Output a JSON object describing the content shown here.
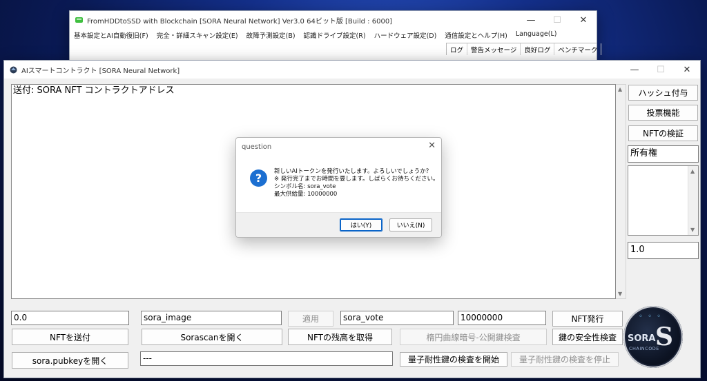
{
  "back_window": {
    "title": "FromHDDtoSSD with Blockchain [SORA Neural Network] Ver3.0 64ビット版 [Build : 6000]",
    "menu": [
      "基本設定とAI自動復旧(F)",
      "完全・詳細スキャン設定(E)",
      "故障予測設定(B)",
      "認識ドライブ設定(R)",
      "ハードウェア設定(D)",
      "通信設定とヘルプ(H)",
      "Language(L)"
    ],
    "tabs": [
      "ログ",
      "警告メッセージ",
      "良好ログ",
      "ベンチマーク"
    ]
  },
  "main_window": {
    "title": "AIスマートコントラクト [SORA Neural Network]",
    "text_area": "送付: SORA NFT コントラクトアドレス",
    "right_panel": {
      "hash_button": "ハッシュ付与",
      "vote_button": "投票機能",
      "nft_verify_button": "NFTの検証",
      "ownership_field": "所有権",
      "version_field": "1.0"
    },
    "row1": {
      "amount_field": "0.0",
      "image_field": "sora_image",
      "apply_button": "適用",
      "symbol_field": "sora_vote",
      "supply_field": "10000000",
      "issue_nft_button": "NFT発行"
    },
    "row2": {
      "send_nft_button": "NFTを送付",
      "open_sorascan_button": "Sorascanを開く",
      "get_balance_button": "NFTの残高を取得",
      "ecc_check_button": "楕円曲線暗号-公開鍵検査",
      "key_safety_button": "鍵の安全性検査"
    },
    "row3": {
      "open_pubkey_button": "sora.pubkeyを開く",
      "status_field": "---",
      "start_quantum_button": "量子耐性鍵の検査を開始",
      "stop_quantum_button": "量子耐性鍵の検査を停止"
    },
    "logo": {
      "word1": "SORA",
      "word2": "CHAINCODE",
      "mark": "S"
    }
  },
  "dialog": {
    "title": "question",
    "lines": [
      "新しいAIトークンを発行いたします。よろしいでしょうか？",
      "※ 発行完了までお時間を要します。しばらくお待ちください。",
      "シンボル名: sora_vote",
      "最大供給量: 10000000"
    ],
    "yes_button": "はい(Y)",
    "no_button": "いいえ(N)"
  },
  "icons": {
    "window_control_minimize": "minimize-icon",
    "window_control_maximize": "maximize-icon",
    "window_control_close": "close-icon",
    "dialog_icon": "question-icon"
  },
  "colors": {
    "dialog_accent": "#1c6fd1",
    "desktop_bg": "#14308c"
  }
}
